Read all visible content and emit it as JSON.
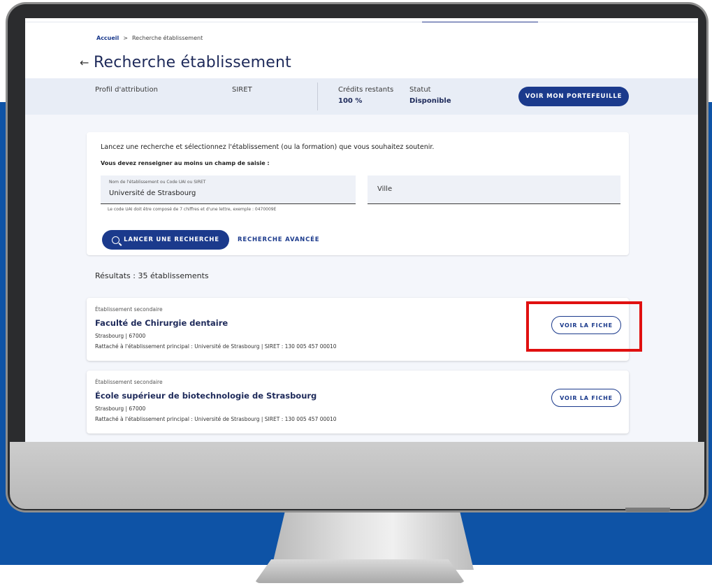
{
  "breadcrumb": {
    "home": "Accueil",
    "separator": ">",
    "current": "Recherche établissement"
  },
  "page": {
    "back_icon": "arrow-left-icon",
    "title": "Recherche établissement"
  },
  "info_bar": {
    "profile_label": "Profil d'attribution",
    "siret_label": "SIRET",
    "credits_label": "Crédits restants",
    "credits_value": "100 %",
    "status_label": "Statut",
    "status_value": "Disponible",
    "wallet_button": "VOIR MON PORTEFEUILLE"
  },
  "search": {
    "instruction": "Lancez une recherche et sélectionnez l'établissement (ou la formation) que vous souhaitez soutenir.",
    "required_note": "Vous devez renseigner au moins un champ de saisie :",
    "name_field_label": "Nom de l'établissement ou Code UAI ou SIRET",
    "name_field_value": "Université de Strasbourg",
    "city_field_label": "Ville",
    "hint": "Le code UAI doit être composé de 7 chiffres et d'une lettre, exemple : 0470009E",
    "search_button": "LANCER UNE RECHERCHE",
    "advanced_link": "RECHERCHE AVANCÉE",
    "search_icon": "search-icon"
  },
  "results": {
    "count_text": "Résultats : 35 établissements",
    "items": [
      {
        "type": "Établissement secondaire",
        "name": "Faculté de Chirurgie dentaire",
        "address": "Strasbourg | 67000",
        "parent": "Rattaché à l'établissement principal : Université de Strasbourg | SIRET : 130 005 457 00010",
        "button": "VOIR LA FICHE"
      },
      {
        "type": "Établissement secondaire",
        "name": "École supérieur de biotechnologie de Strasbourg",
        "address": "Strasbourg | 67000",
        "parent": "Rattaché à l'établissement principal : Université de Strasbourg | SIRET : 130 005 457 00010",
        "button": "VOIR LA FICHE"
      }
    ]
  },
  "colors": {
    "primary": "#1b3a8c",
    "background_band": "#0e53a6",
    "highlight": "#e01010",
    "info_bar": "#e8edf6"
  }
}
